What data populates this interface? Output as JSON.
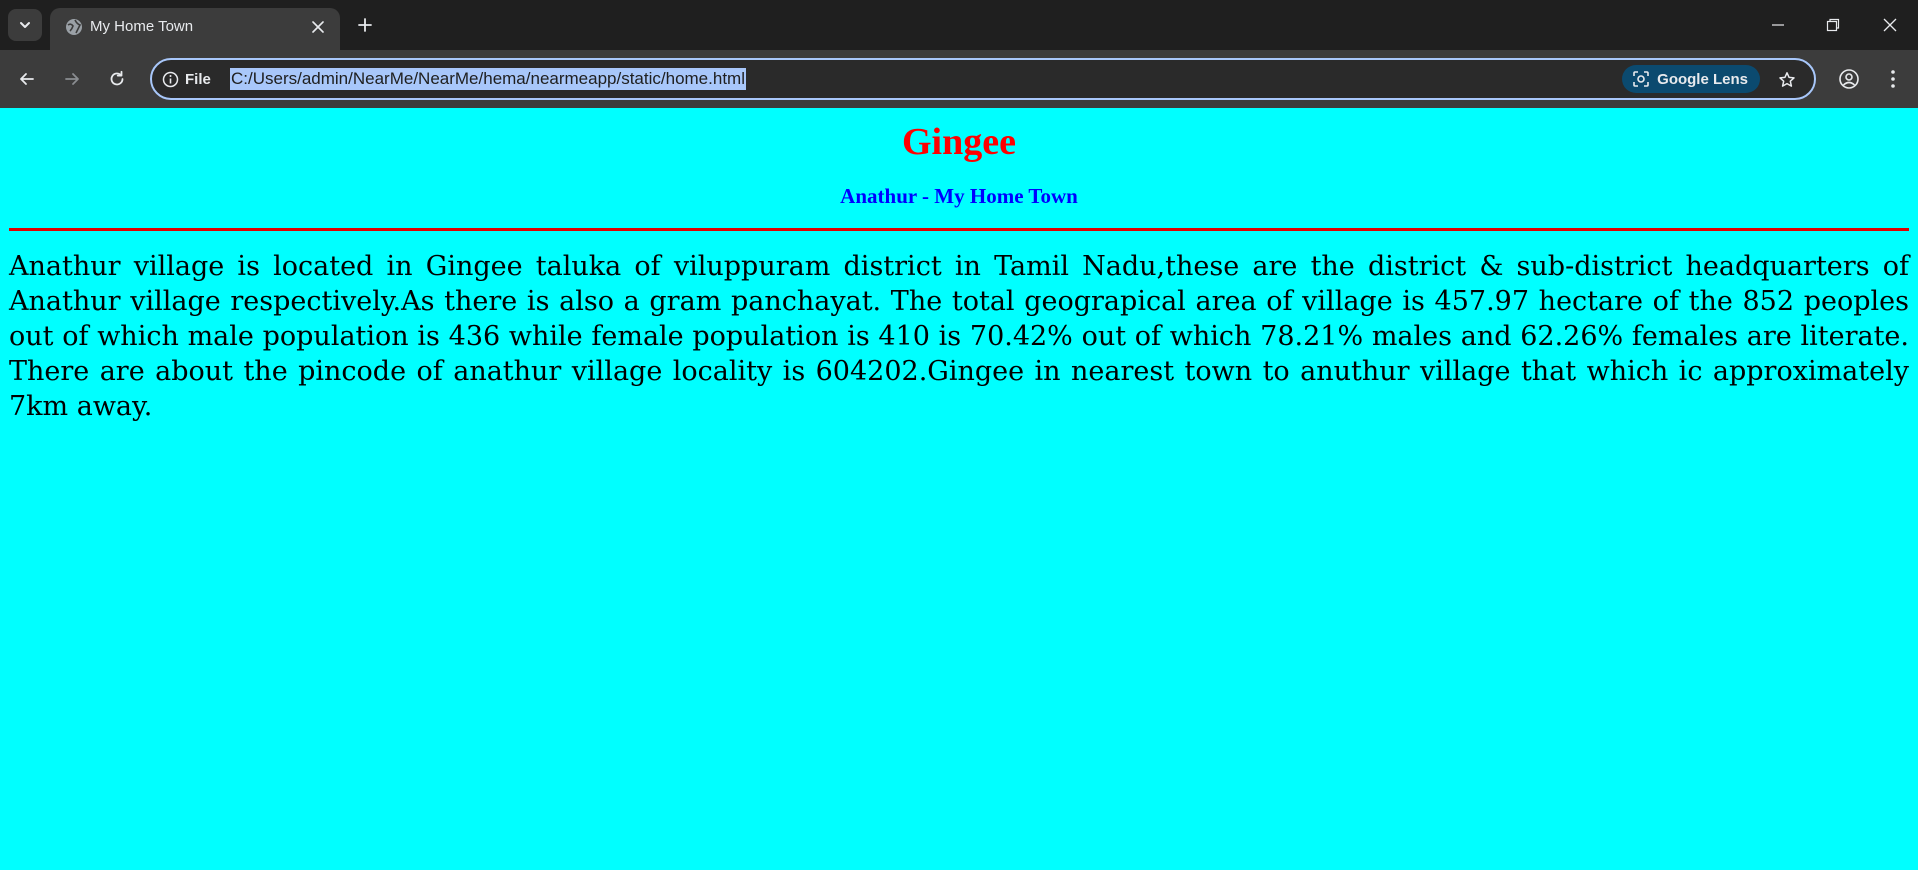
{
  "browser": {
    "tab": {
      "title": "My Home Town"
    },
    "omnibox": {
      "site_info_label": "File",
      "url": "C:/Users/admin/NearMe/NearMe/hema/nearmeapp/static/home.html",
      "lens_label": "Google Lens"
    },
    "icons": {
      "tab_search": "chevron-down-icon",
      "favicon": "globe-icon",
      "tab_close": "close-icon",
      "new_tab": "plus-icon",
      "back": "arrow-left-icon",
      "forward": "arrow-right-icon",
      "reload": "reload-icon",
      "site_info": "info-icon",
      "lens": "camera-search-icon",
      "bookmark": "star-icon",
      "profile": "account-icon",
      "menu": "kebab-menu-icon",
      "minimize": "minimize-icon",
      "restore": "restore-icon",
      "close_window": "close-icon"
    }
  },
  "page": {
    "heading": "Gingee",
    "subheading": "Anathur - My Home Town",
    "paragraph": "Anathur village is located in Gingee taluka of viluppuram district in Tamil Nadu,these are the district & sub-district headquarters of Anathur village respectively.As there is also a gram panchayat. The total geograpical area of village is 457.97 hectare of the 852 peoples out of which male population is 436 while female population is 410 is 70.42% out of which 78.21% males and 62.26% females are literate. There are about the pincode of anathur village locality is 604202.Gingee in nearest town to anuthur village that which ic approximately 7km away."
  },
  "colors": {
    "page_background": "#00ffff",
    "heading": "#ff0000",
    "subheading": "#0000ff",
    "rule": "#e00000",
    "body_text": "#000000"
  }
}
